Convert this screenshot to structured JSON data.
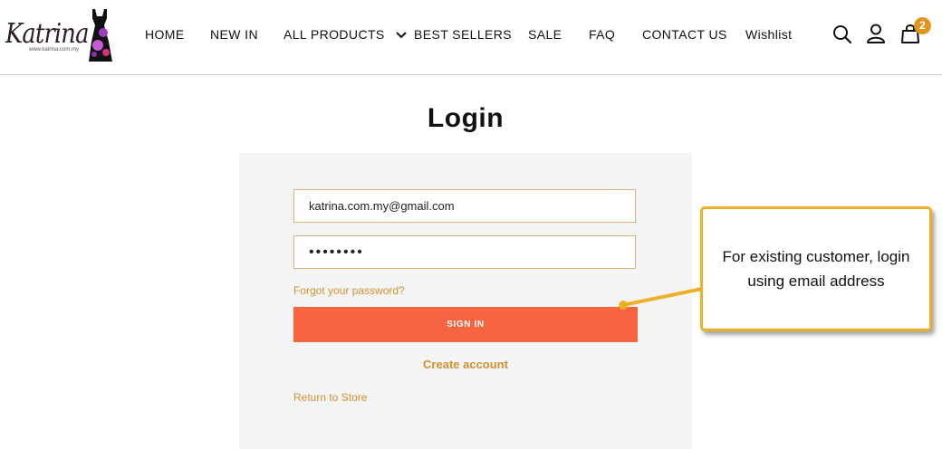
{
  "brand": {
    "logo_text": "Katrina",
    "logo_subtext": "www.katrina.com.my"
  },
  "nav": {
    "items": [
      "HOME",
      "NEW IN",
      "ALL PRODUCTS",
      "BEST SELLERS",
      "SALE",
      "FAQ",
      "CONTACT US",
      "Wishlist"
    ]
  },
  "header_icons": {
    "search": "search-icon",
    "account": "user-icon",
    "cart": "shopping-bag-icon",
    "cart_count": "2",
    "badge_color": "#e0961e"
  },
  "login": {
    "title": "Login",
    "email_value": "katrina.com.my@gmail.com",
    "password_value": "••••••••",
    "forgot_label": "Forgot your password?",
    "signin_label": "SIGN IN",
    "create_label": "Create account",
    "return_label": "Return to Store"
  },
  "annotation": {
    "text": "For existing customer, login using email address",
    "border_color": "#ecaf28"
  },
  "colors": {
    "accent": "#d4902f",
    "button": "#f76440",
    "panel": "#f4f4f4"
  }
}
